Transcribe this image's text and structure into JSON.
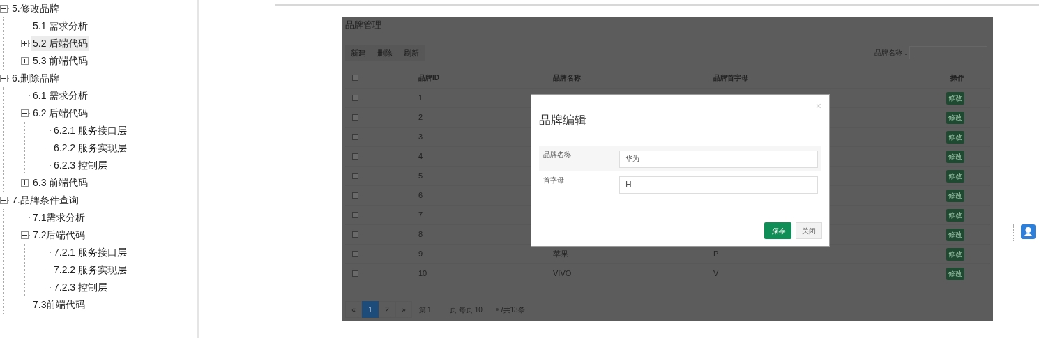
{
  "tree": [
    {
      "label": "5.修改品牌",
      "expanded": true,
      "selected": false,
      "children": [
        {
          "label": "5.1 需求分析",
          "selected": false
        },
        {
          "label": "5.2 后端代码",
          "expanded": false,
          "selected": true
        },
        {
          "label": "5.3 前端代码",
          "expanded": false,
          "selected": false
        }
      ]
    },
    {
      "label": "6.删除品牌",
      "expanded": true,
      "selected": false,
      "children": [
        {
          "label": "6.1 需求分析",
          "selected": false
        },
        {
          "label": "6.2 后端代码",
          "expanded": true,
          "selected": false,
          "children": [
            {
              "label": "6.2.1 服务接口层",
              "selected": false
            },
            {
              "label": "6.2.2 服务实现层",
              "selected": false
            },
            {
              "label": "6.2.3 控制层",
              "selected": false
            }
          ]
        },
        {
          "label": "6.3 前端代码",
          "expanded": false,
          "selected": false
        }
      ]
    },
    {
      "label": "7.品牌条件查询",
      "expanded": true,
      "selected": false,
      "children": [
        {
          "label": "7.1需求分析",
          "selected": false
        },
        {
          "label": "7.2后端代码",
          "expanded": true,
          "selected": false,
          "children": [
            {
              "label": "7.2.1 服务接口层",
              "selected": false
            },
            {
              "label": "7.2.2 服务实现层",
              "selected": false
            },
            {
              "label": "7.2.3 控制层",
              "selected": false
            }
          ]
        },
        {
          "label": "7.3前端代码",
          "selected": false
        }
      ]
    }
  ],
  "brand_panel": {
    "title": "品牌管理",
    "toolbar": [
      "新建",
      "删除",
      "刷新"
    ],
    "search_label": "品牌名称：",
    "all_checked": false,
    "columns": [
      "品牌ID",
      "品牌名称",
      "品牌首字母",
      "操作"
    ],
    "rows": [
      {
        "checked": false,
        "id": "1",
        "action": "修改"
      },
      {
        "checked": false,
        "id": "2",
        "action": "修改"
      },
      {
        "checked": false,
        "id": "3",
        "action": "修改"
      },
      {
        "checked": false,
        "id": "4",
        "action": "修改"
      },
      {
        "checked": false,
        "id": "5",
        "action": "修改"
      },
      {
        "checked": false,
        "id": "6",
        "action": "修改"
      },
      {
        "checked": false,
        "id": "7",
        "action": "修改"
      },
      {
        "checked": false,
        "id": "8",
        "action": "修改"
      },
      {
        "checked": false,
        "id": "9",
        "name": "苹果",
        "letter": "P",
        "action": "修改"
      },
      {
        "checked": false,
        "id": "10",
        "name": "VIVO",
        "letter": "V",
        "action": "修改"
      }
    ],
    "pagination": {
      "prev": "«",
      "pages": [
        {
          "label": "1",
          "selected": true
        },
        {
          "label": "2",
          "selected": false
        }
      ],
      "next": "»",
      "page_prefix": "第",
      "page_value": "1",
      "page_suffix": "页 每页",
      "page_size": "10",
      "total": "/共13条"
    }
  },
  "dialog": {
    "title": "品牌编辑",
    "close": "×",
    "fields": [
      {
        "label": "品牌名称",
        "value": "华为"
      },
      {
        "label": "首字母",
        "value": "H"
      }
    ],
    "save": "保存",
    "cancel": "关闭"
  }
}
